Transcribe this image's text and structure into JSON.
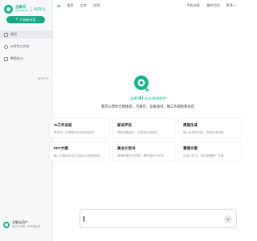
{
  "brand": {
    "name_cn": "全解云",
    "name_en": "QuanJieYun",
    "sub": "AI办公"
  },
  "sidebar": {
    "new_button": "开启新对话",
    "items": [
      {
        "label": "首页"
      },
      {
        "label": "AI写作工作台"
      },
      {
        "label": "数智办公"
      }
    ],
    "history_label": "暂无历史"
  },
  "user": {
    "name": "全解云用户",
    "meta": "会员已过期，可开通会员"
  },
  "nav": {
    "tabs": [
      {
        "label": "AI"
      },
      {
        "label": "首页"
      },
      {
        "label": "工作"
      },
      {
        "label": "应用"
      }
    ],
    "right": [
      {
        "label": "手机浏览"
      },
      {
        "label": "我的空间"
      },
      {
        "label": "更多"
      }
    ]
  },
  "hero": {
    "tagline_prefix": "全解",
    "tagline_ai": "AI",
    "tagline_suffix": "办公高效助手",
    "description": "我可以帮你全网搜索、写报告、准备面试，做工作规划和总结"
  },
  "cards": [
    {
      "title": "AI工作总结",
      "desc": "帮你写一份清晰的年终总结报告"
    },
    {
      "title": "面试评估",
      "desc": "帮你准备面试，并提供反馈建议"
    },
    {
      "title": "周报生成",
      "desc": "输入本周的内容，快速生成周报"
    },
    {
      "title": "PPT大纲",
      "desc": "输入主题后自动生成演示文稿的结构"
    },
    {
      "title": "商业计划书",
      "desc": "帮你梳理业务思路，撰写规范计划书"
    },
    {
      "title": "营销文案",
      "desc": "生成小红书、朋友圈等推广文案"
    }
  ],
  "colors": {
    "accent": "#19b88f",
    "button": "#1aa984"
  }
}
